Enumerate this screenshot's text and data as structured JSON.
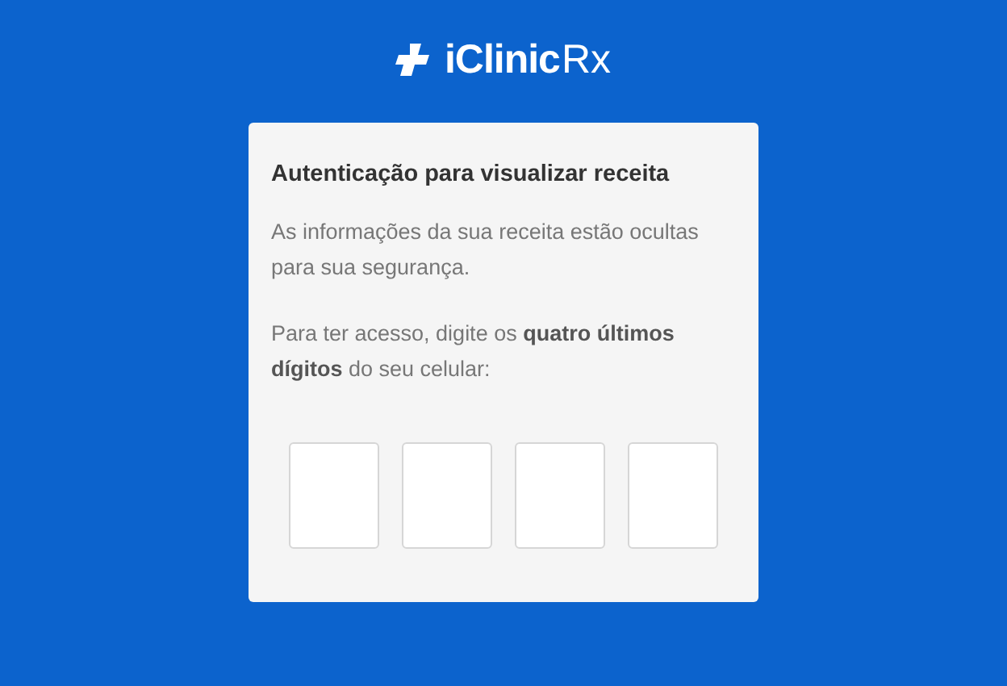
{
  "logo": {
    "brand": "iClinic",
    "suffix": "Rx"
  },
  "card": {
    "title": "Autenticação para visualizar receita",
    "info": "As informações da sua receita estão ocultas para sua segurança.",
    "instruction": "Para ter acesso, digite os **quatro últimos dígitos** do seu celular:",
    "digit_fields": [
      {
        "kind": "digit"
      },
      {
        "kind": "digit"
      },
      {
        "kind": "digit"
      },
      {
        "kind": "digit"
      }
    ]
  }
}
